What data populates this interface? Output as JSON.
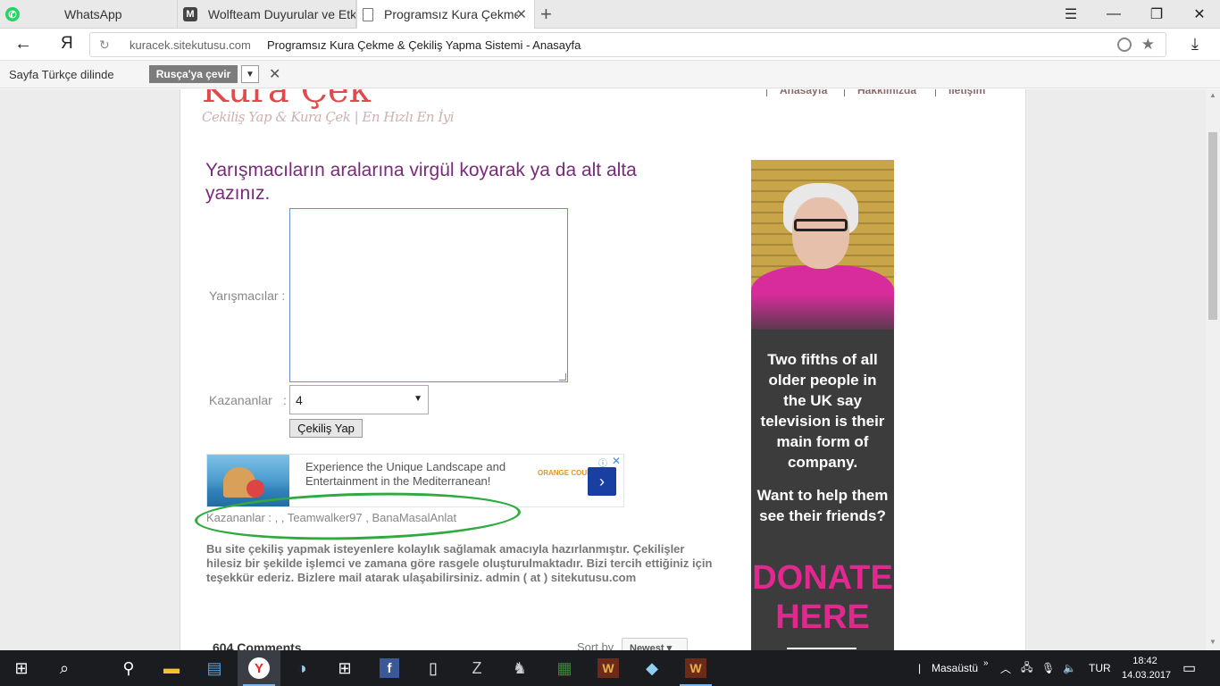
{
  "browser": {
    "tabs": [
      {
        "title": "WhatsApp",
        "icon": "whatsapp-icon",
        "color": "#25d366"
      },
      {
        "title": "Wolfteam Duyurular ve Etkin",
        "icon": "m-logo-icon",
        "color": "#444444"
      },
      {
        "title": "Programsız Kura Çekme &",
        "icon": "page-icon",
        "color": "#ffffff"
      }
    ],
    "address": {
      "host": "kuracek.sitekutusu.com",
      "page_title": "Programsız Kura Çekme & Çekiliş Yapma Sistemi - Anasayfa"
    },
    "translate_bar": {
      "label": "Sayfa Türkçe dilinde",
      "button": "Rusça'ya çevir"
    }
  },
  "site": {
    "logo": "Kura Çek",
    "tagline": "Cekiliş Yap & Kura Çek | En Hızlı En İyi",
    "nav": [
      "Anasayfa",
      "Hakkımızda",
      "İletişim"
    ]
  },
  "form": {
    "heading": "Yarışmacıların aralarına virgül koyarak ya da alt alta yazınız.",
    "participants_label": "Yarışmacılar :",
    "participants_value": "",
    "winners_label": "Kazananlar",
    "winners_colon": ":",
    "winners_count": "4",
    "submit": "Çekiliş Yap"
  },
  "ad_banner": {
    "text": "Experience the Unique Landscape and Entertainment in the Mediterranean!",
    "brand": "ORANGE COUNTY"
  },
  "result": {
    "text": "Kazananlar : , , Teamwalker97 , BanaMasalAnlat"
  },
  "about": "Bu site çekiliş yapmak isteyenlere kolaylık sağlamak amacıyla hazırlanmıştır. Çekilişler hilesiz bir şekilde işlemci ve zamana göre rasgele oluşturulmaktadır. Bizi tercih ettiğiniz için teşekkür ederiz. Bizlere mail atarak ulaşabilirsiniz. admin ( at ) sitekutusu.com",
  "comments": {
    "count": "604 Comments",
    "sort_label": "Sort by",
    "sort_value": "Newest"
  },
  "side_ad": {
    "message1": "Two fifths of all older people in the UK say television is their main form of company.",
    "message2": "Want to help them see their friends?",
    "cta": "DONATE HERE",
    "accent": "#e0288f"
  },
  "taskbar": {
    "desktop_label": "Masaüstü",
    "lang": "TUR",
    "time": "18:42",
    "date": "14.03.2017"
  }
}
